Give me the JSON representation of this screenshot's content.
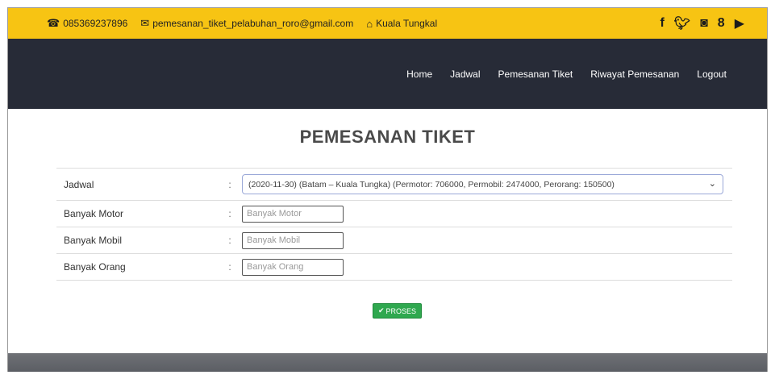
{
  "topbar": {
    "phone": "085369237896",
    "email": "pemesanan_tiket_pelabuhan_roro@gmail.com",
    "location": "Kuala Tungkal",
    "social_icons": [
      "facebook-icon",
      "twitter-icon",
      "instagram-icon",
      "google-plus-icon",
      "youtube-icon"
    ]
  },
  "nav": {
    "items": [
      "Home",
      "Jadwal",
      "Pemesanan Tiket",
      "Riwayat Pemesanan",
      "Logout"
    ]
  },
  "page": {
    "title": "PEMESANAN TIKET"
  },
  "form": {
    "colon": ":",
    "jadwal_label": "Jadwal",
    "jadwal_value": "(2020-11-30) (Batam – Kuala Tungka) (Permotor: 706000, Permobil: 2474000, Perorang: 150500)",
    "motor_label": "Banyak Motor",
    "motor_placeholder": "Banyak Motor",
    "mobil_label": "Banyak Mobil",
    "mobil_placeholder": "Banyak Mobil",
    "orang_label": "Banyak Orang",
    "orang_placeholder": "Banyak Orang",
    "submit_label": "PROSES"
  },
  "colors": {
    "topbar": "#f7c413",
    "navbar": "#272b37",
    "button": "#2fa84f"
  }
}
